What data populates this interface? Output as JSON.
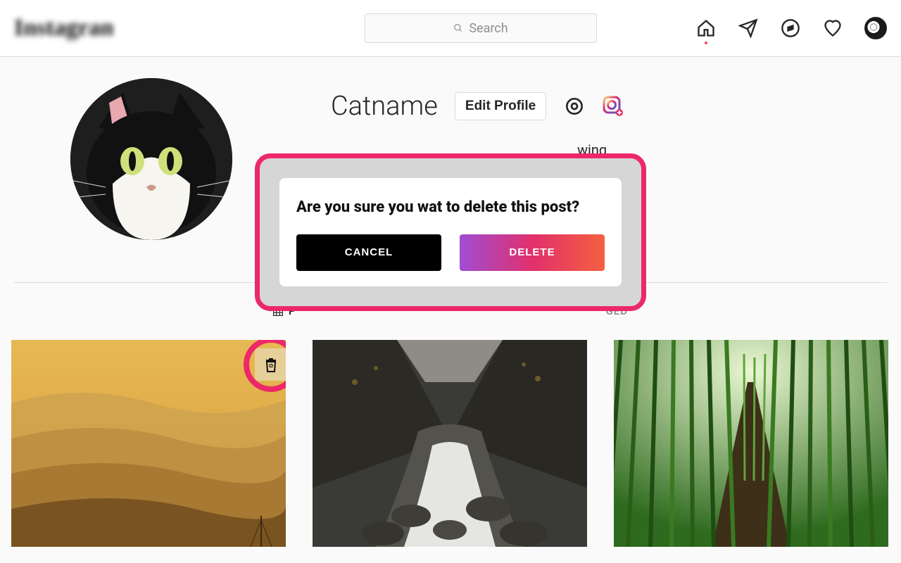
{
  "nav": {
    "search_placeholder": "Search",
    "icons": {
      "home": "home-icon",
      "messages": "paper-plane-icon",
      "explore": "compass-icon",
      "activity": "heart-icon",
      "avatar": "profile-avatar"
    }
  },
  "profile": {
    "username": "Catname",
    "edit_label": "Edit Profile",
    "following_label": "wing"
  },
  "tabs": {
    "posts": "POSTS",
    "tagged": "GED"
  },
  "modal": {
    "title": "Are you sure you wat to delete this post?",
    "cancel": "CANCEL",
    "delete": "DELETE"
  },
  "colors": {
    "accent_pink": "#ec2869",
    "gradient_start": "#a04dd4",
    "gradient_mid": "#e1306c",
    "gradient_end": "#f56040"
  }
}
